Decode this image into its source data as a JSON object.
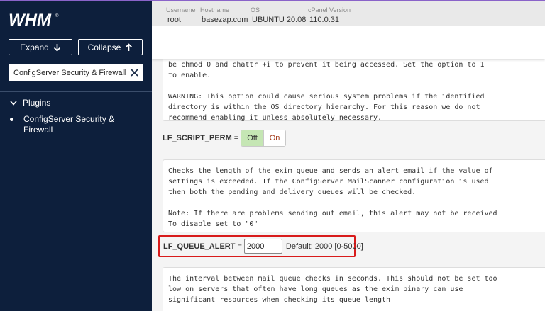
{
  "header": {
    "fields": [
      {
        "label": "Username",
        "value": "root"
      },
      {
        "label": "Hostname",
        "value": "basezap.com"
      },
      {
        "label": "OS",
        "value": "UBUNTU 20.08"
      },
      {
        "label": "cPanel Version",
        "value": "110.0.31"
      }
    ]
  },
  "sidebar": {
    "expand_label": "Expand",
    "collapse_label": "Collapse",
    "search_value": "ConfigServer Security & Firewall",
    "section_label": "Plugins",
    "plugin_item": "ConfigServer Security & Firewall"
  },
  "content": {
    "panel1_text": "be chmod 0 and chattr +i to prevent it being accessed. Set the option to 1\nto enable.\n\nWARNING: This option could cause serious system problems if the identified\ndirectory is within the OS directory hierarchy. For this reason we do not\nrecommend enabling it unless absolutely necessary.",
    "option1_name": "LF_SCRIPT_PERM",
    "option1_eq": "=",
    "option1_off": "Off",
    "option1_on": "On",
    "panel2_text": "Checks the length of the exim queue and sends an alert email if the value of\nsettings is exceeded. If the ConfigServer MailScanner configuration is used\nthen both the pending and delivery queues will be checked.\n\nNote: If there are problems sending out email, this alert may not be received\nTo disable set to \"0\"",
    "option2_name": "LF_QUEUE_ALERT",
    "option2_eq": "=",
    "option2_value": "2000",
    "option2_default": "Default: 2000 [0-5000]",
    "panel3_text": "The interval between mail queue checks in seconds. This should not be set too\nlow on servers that often have long queues as the exim binary can use\nsignificant resources when checking its queue length"
  },
  "colors": {
    "sidebar_bg": "#0d1f3c",
    "accent": "#8a63c9",
    "highlight": "#d81b1b",
    "toggle_active": "#c5e6b4"
  }
}
